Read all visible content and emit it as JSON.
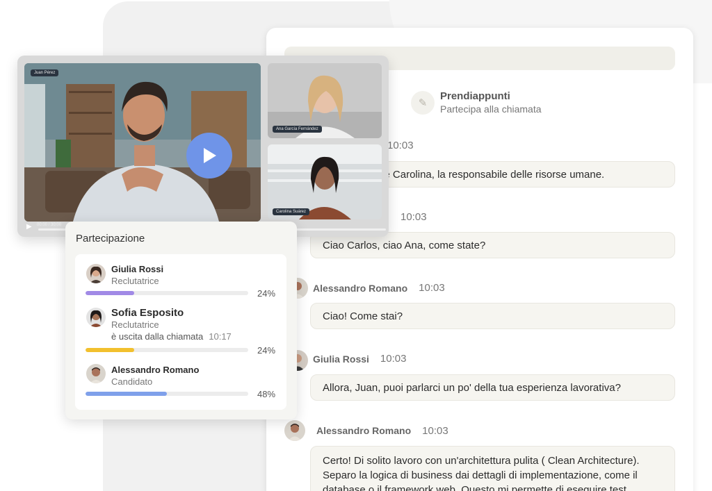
{
  "colors": {
    "accent_blue": "#6f94e8",
    "bar_purple": "#a18ae6",
    "bar_yellow": "#f2c02e",
    "bar_blue": "#7fa0ea"
  },
  "video": {
    "main_tag": "Juan Pérez",
    "side_tag_1": "Ana García Fernández",
    "side_tag_2": "Carolina Suárez",
    "timestamp": "00:00 / 30:00"
  },
  "chat": {
    "top_bar_text": "",
    "notes": {
      "title": "Prendiappunti",
      "subtitle": "Partecipa alla chiamata",
      "icon": "pencil-icon"
    },
    "messages": [
      {
        "name": "",
        "time": "10:03",
        "text": "Ciao, questa è Carolina, la responsabile delle risorse umane."
      },
      {
        "name": "",
        "time": "10:03",
        "text": "Ciao Carlos, ciao Ana, come state?"
      },
      {
        "name": "Alessandro Romano",
        "time": "10:03",
        "text": "Ciao! Come stai?"
      },
      {
        "name": "Giulia Rossi",
        "time": "10:03",
        "text": "Allora, Juan, puoi parlarci un po' della tua esperienza lavorativa?"
      },
      {
        "name": "Alessandro Romano",
        "time": "10:03",
        "text_lines": [
          "Certo! Di solito lavoro con un'architettura pulita ( Clean Architecture).",
          "Separo la logica di business dai dettagli di implementazione, come il",
          "database o il framework web. Questo mi permette di eseguire test"
        ]
      }
    ]
  },
  "participation": {
    "title": "Partecipazione",
    "people": [
      {
        "name": "Giulia Rossi",
        "role": "Reclutatrice",
        "percent_label": "24%",
        "percent": 0.3
      },
      {
        "name": "Sofia Esposito",
        "role": "Reclutatrice",
        "left_text": "è uscita dalla chiamata",
        "left_time": "10:17",
        "percent_label": "24%",
        "percent": 0.3
      },
      {
        "name": "Alessandro Romano",
        "role": "Candidato",
        "percent_label": "48%",
        "percent": 0.5
      }
    ]
  }
}
